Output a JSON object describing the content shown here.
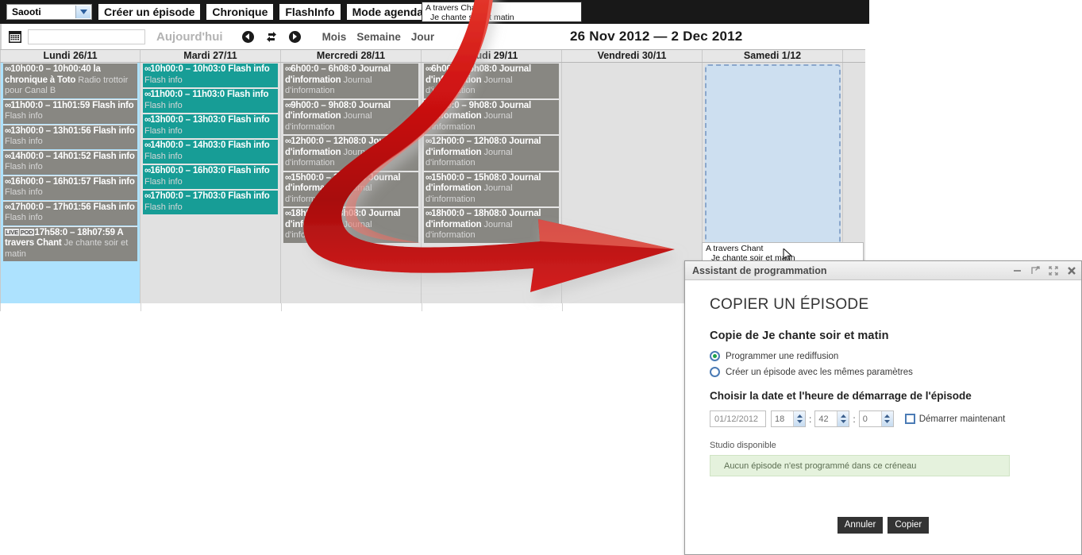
{
  "topbar": {
    "station": "Saooti",
    "buttons": [
      {
        "label": "Créer un épisode",
        "name": "creer-un-episode-button"
      },
      {
        "label": "Chronique",
        "name": "chronique-button"
      },
      {
        "label": "FlashInfo",
        "name": "flashinfo-button"
      },
      {
        "label": "Mode agenda",
        "name": "mode-agenda-button"
      }
    ],
    "episode_chip": {
      "title": "A travers Chant",
      "subtitle": "Je chante soir et matin"
    }
  },
  "navbar": {
    "date_value": "",
    "date_placeholder": "",
    "today_label": "Aujourd'hui",
    "views": [
      "Mois",
      "Semaine",
      "Jour"
    ],
    "range_title": "26 Nov 2012 — 2 Dec 2012"
  },
  "calendar": {
    "days": [
      {
        "label": "Lundi 26/11",
        "highlight": true
      },
      {
        "label": "Mardi 27/11",
        "highlight": false
      },
      {
        "label": "Mercredi 28/11",
        "highlight": false
      },
      {
        "label": "Jeudi 29/11",
        "highlight": false
      },
      {
        "label": "Vendredi 30/11",
        "highlight": false
      },
      {
        "label": "Samedi 1/12",
        "highlight": false
      }
    ],
    "monday_events": [
      {
        "badges": [],
        "time": "10h00:0 – 10h00:40",
        "title": "la chronique à Toto",
        "sub": "Radio trottoir pour Canal B",
        "lines": 3
      },
      {
        "badges": [],
        "time": "11h00:0 – 11h01:59",
        "title": "Flash info",
        "sub": "Flash info",
        "lines": 2
      },
      {
        "badges": [],
        "time": "13h00:0 – 13h01:56",
        "title": "Flash info",
        "sub": "Flash info",
        "lines": 2
      },
      {
        "badges": [],
        "time": "14h00:0 – 14h01:52",
        "title": "Flash info",
        "sub": "Flash info",
        "lines": 2
      },
      {
        "badges": [],
        "time": "16h00:0 – 16h01:57",
        "title": "Flash info",
        "sub": "Flash info",
        "lines": 2
      },
      {
        "badges": [],
        "time": "17h00:0 – 17h01:56",
        "title": "Flash info",
        "sub": "Flash info",
        "lines": 2
      },
      {
        "badges": [
          "LIVE",
          "POD"
        ],
        "time": "17h58:0 – 18h07:59",
        "title": "A travers Chant",
        "sub": "Je chante soir et matin",
        "lines": 3
      }
    ],
    "tuesday_events": [
      {
        "time": "10h00:0 – 10h03:0",
        "title": "Flash info",
        "sub": "Flash info"
      },
      {
        "time": "11h00:0 – 11h03:0",
        "title": "Flash info",
        "sub": "Flash info"
      },
      {
        "time": "13h00:0 – 13h03:0",
        "title": "Flash info",
        "sub": "Flash info"
      },
      {
        "time": "14h00:0 – 14h03:0",
        "title": "Flash info",
        "sub": "Flash info"
      },
      {
        "time": "16h00:0 – 16h03:0",
        "title": "Flash info",
        "sub": "Flash info"
      },
      {
        "time": "17h00:0 – 17h03:0",
        "title": "Flash info",
        "sub": "Flash info"
      }
    ],
    "wednesday_events": [
      {
        "time": "6h00:0 – 6h08:0",
        "title": "Journal d'information",
        "sub": "Journal d'information"
      },
      {
        "time": "9h00:0 – 9h08:0",
        "title": "Journal d'information",
        "sub": "Journal d'information"
      },
      {
        "time": "12h00:0 – 12h08:0",
        "title": "Journal d'information",
        "sub": "Journal d'information"
      },
      {
        "time": "15h00:0 – 15h08:0",
        "title": "Journal d'information",
        "sub": "Journal d'information"
      },
      {
        "time": "18h00:0 – 18h08:0",
        "title": "Journal d'information",
        "sub": "Journal d'information"
      }
    ],
    "thursday_events": [
      {
        "time": "6h00:0 – 6h08:0",
        "title": "Journal d'information",
        "sub": "Journal d'information"
      },
      {
        "time": "9h00:0 – 9h08:0",
        "title": "Journal d'information",
        "sub": "Journal d'information"
      },
      {
        "time": "12h00:0 – 12h08:0",
        "title": "Journal d'information",
        "sub": "Journal d'information"
      },
      {
        "time": "15h00:0 – 15h08:0",
        "title": "Journal d'information",
        "sub": "Journal d'information"
      },
      {
        "time": "18h00:0 – 18h08:0",
        "title": "Journal d'information",
        "sub": "Journal d'information"
      }
    ],
    "friday_events": [],
    "saturday_events": [],
    "infinity_glyph": "∞"
  },
  "tooltip": {
    "title": "A travers Chant",
    "subtitle": "Je chante soir et matin"
  },
  "dialog": {
    "window_title": "Assistant de programmation",
    "heading": "COPIER UN ÉPISODE",
    "subheading": "Copie de Je chante soir et matin",
    "options": [
      {
        "label": "Programmer une rediffusion",
        "selected": true
      },
      {
        "label": "Créer un épisode avec les mêmes paramètres",
        "selected": false
      }
    ],
    "datetime_label": "Choisir la date et l'heure de démarrage de l'épisode",
    "date_value": "01/12/2012",
    "hour_value": "18",
    "minute_value": "42",
    "second_value": "0",
    "separator": ":",
    "start_now_label": "Démarrer maintenant",
    "start_now_checked": false,
    "studio_label": "Studio disponible",
    "studio_message": "Aucun épisode n'est programmé dans ce créneau",
    "cancel_label": "Annuler",
    "copy_label": "Copier"
  },
  "colors": {
    "topbar_bg": "#181818",
    "event_grey": "#888782",
    "event_teal": "#179d96",
    "monday_highlight": "#ade2fe",
    "selection_fill": "#cddff0",
    "selection_border": "#8aa7cc",
    "arrow_red": "#cc1111",
    "studio_ok_bg": "#e5f2dd",
    "button_dark": "#333333",
    "radio_blue": "#4b7bb5",
    "radio_dot_green": "#1ea34a"
  }
}
